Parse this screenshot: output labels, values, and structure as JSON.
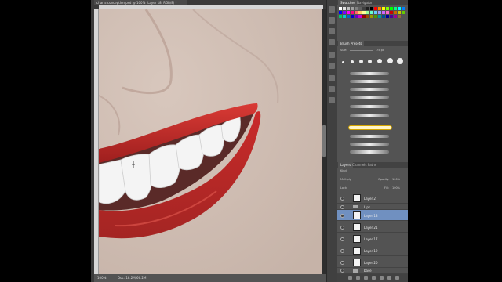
{
  "document": {
    "tab_title": "charts-conception.psd @ 100% (Layer 18, RGB/8) *",
    "zoom": "100%",
    "doc_info": "Doc: 18.2M/66.2M"
  },
  "panels": {
    "swatches": {
      "tabs": [
        "Swatches",
        "Navigator"
      ],
      "colors": [
        "#ffffff",
        "#e0e0e0",
        "#c0c0c0",
        "#a0a0a0",
        "#808080",
        "#606060",
        "#404040",
        "#202020",
        "#000000",
        "#ff0000",
        "#ff8000",
        "#ffff00",
        "#80ff00",
        "#00ff00",
        "#00ff80",
        "#00ffff",
        "#0080ff",
        "#0000ff",
        "#8000ff",
        "#ff00ff",
        "#ff0080",
        "#ff6666",
        "#ffcc66",
        "#ffff99",
        "#99ff99",
        "#66ffcc",
        "#66ccff",
        "#9999ff",
        "#cc66ff",
        "#ff66cc",
        "#cc0000",
        "#cc6600",
        "#cccc00",
        "#66cc00",
        "#00cc66",
        "#00cccc",
        "#0066cc",
        "#0000cc",
        "#6600cc",
        "#cc00cc",
        "#990000",
        "#994c00",
        "#999900",
        "#4c9900",
        "#009999",
        "#004c99",
        "#000099",
        "#4c0099",
        "#990099",
        "#996633"
      ]
    },
    "brush_presets": {
      "title": "Brush Presets",
      "size_label": "Size:",
      "size_value": "75 px"
    },
    "layers": {
      "tabs": [
        "Layers",
        "Channels",
        "Paths"
      ],
      "kind_label": "Kind",
      "blend_mode": "Multiply",
      "opacity_label": "Opacity:",
      "opacity_value": "100%",
      "lock_label": "Lock:",
      "fill_label": "Fill:",
      "fill_value": "100%",
      "items": [
        {
          "name": "Layer 2"
        },
        {
          "name": "Lips"
        },
        {
          "name": "Layer 18"
        },
        {
          "name": "Layer 21"
        },
        {
          "name": "Layer 17"
        },
        {
          "name": "Layer 19"
        },
        {
          "name": "Layer 20"
        },
        {
          "name": "base"
        }
      ]
    }
  }
}
